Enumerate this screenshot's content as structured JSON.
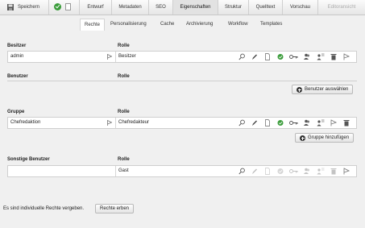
{
  "toolbar": {
    "save_label": "Speichern",
    "tabs": [
      {
        "label": "Entwurf",
        "state": "normal"
      },
      {
        "label": "Metadaten",
        "state": "normal"
      },
      {
        "label": "SEO",
        "state": "normal"
      },
      {
        "label": "Eigenschaften",
        "state": "active"
      },
      {
        "label": "Struktur",
        "state": "normal"
      },
      {
        "label": "Quelltext",
        "state": "normal"
      },
      {
        "label": "Vorschau",
        "state": "normal"
      },
      {
        "label": "Editoransicht",
        "state": "disabled"
      }
    ]
  },
  "subnav": {
    "items": [
      {
        "label": "Rechte",
        "state": "active"
      },
      {
        "label": "Personalisierung"
      },
      {
        "label": "Cache"
      },
      {
        "label": "Archivierung"
      },
      {
        "label": "Workflow"
      },
      {
        "label": "Templates"
      }
    ]
  },
  "sections": {
    "besitzer": {
      "left_header": "Besitzer",
      "right_header": "Rolle",
      "row": {
        "left": "admin",
        "right": "Besitzer"
      }
    },
    "benutzer": {
      "left_header": "Benutzer",
      "right_header": "Rolle",
      "button_label": "Benutzer auswählen"
    },
    "gruppe": {
      "left_header": "Gruppe",
      "right_header": "Rolle",
      "row": {
        "left": "Chefredaktion",
        "right": "Chefredakteur"
      },
      "button_label": "Gruppe hinzufügen"
    },
    "sonstige": {
      "left_header": "Sonstige Benutzer",
      "right_header": "Rolle",
      "row": {
        "left": "",
        "right": "Gast"
      }
    }
  },
  "footer": {
    "text": "Es sind individuelle Rechte vergeben.",
    "button_label": "Rechte erben"
  },
  "colors": {
    "check_green": "#3a9c3a",
    "toolbar_bg": "#eeeeee",
    "panel_bg": "#f0f0f0"
  }
}
